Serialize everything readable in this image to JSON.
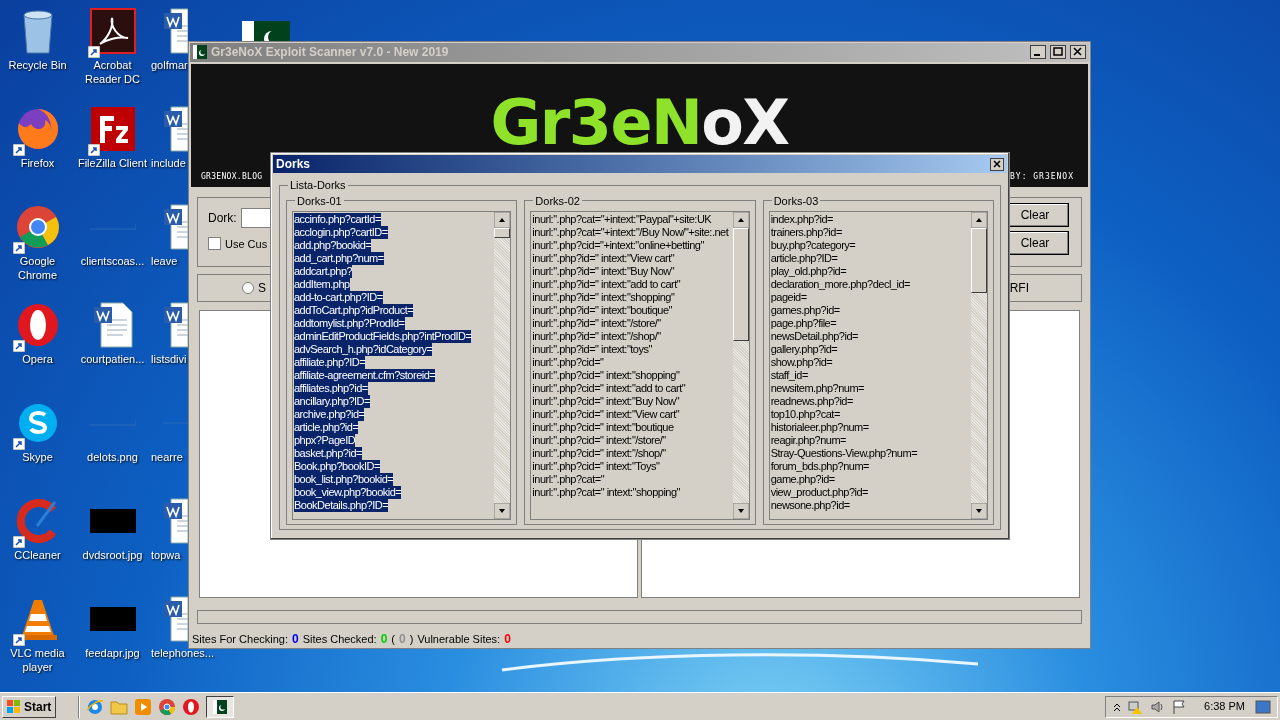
{
  "desktop_icons": [
    {
      "label": "Recycle Bin",
      "kind": "recycle"
    },
    {
      "label": "Firefox",
      "kind": "firefox"
    },
    {
      "label": "Google Chrome",
      "kind": "chrome"
    },
    {
      "label": "Opera",
      "kind": "opera"
    },
    {
      "label": "Skype",
      "kind": "skype"
    },
    {
      "label": "CCleaner",
      "kind": "ccleaner"
    },
    {
      "label": "VLC media player",
      "kind": "vlc"
    },
    {
      "label": "Acrobat Reader DC",
      "kind": "pdf"
    },
    {
      "label": "FileZilla Client",
      "kind": "filezilla"
    },
    {
      "label": "clientscoas...",
      "kind": "blank"
    },
    {
      "label": "courtpatien...",
      "kind": "word"
    },
    {
      "label": "delots.png",
      "kind": "blank"
    },
    {
      "label": "dvdsroot.jpg",
      "kind": "black"
    },
    {
      "label": "feedapr.jpg",
      "kind": "black"
    },
    {
      "label": "golfmar",
      "kind": "word"
    },
    {
      "label": "include",
      "kind": "word"
    },
    {
      "label": "leave",
      "kind": "word"
    },
    {
      "label": "listsdivi",
      "kind": "word"
    },
    {
      "label": "nearre",
      "kind": "blank"
    },
    {
      "label": "topwa",
      "kind": "word"
    },
    {
      "label": "telephones...",
      "kind": "word"
    },
    {
      "kind": "flag"
    }
  ],
  "main_window": {
    "title": "Gr3eNoX Exploit Scanner v7.0 - New 2019",
    "logo_parts": [
      {
        "text": "Gr3eN",
        "kind": "green"
      },
      {
        "text": "oX",
        "kind": "white"
      }
    ],
    "banner_left": "GR3ENOX.BLOG",
    "banner_right": "BY: GR3ENOX",
    "dork_label": "Dork:",
    "use_custom": {
      "label": "Use Cus",
      "checked": false
    },
    "buttons": [
      "Clear",
      "Clear"
    ],
    "radios": [
      {
        "label": "S",
        "selected": false
      },
      {
        "label": "RFI"
      }
    ],
    "progress": {
      "level": 0
    },
    "status": [
      {
        "text": "Sites For Checking:",
        "kind": "label"
      },
      {
        "text": "0",
        "kind": "value",
        "color": "#0000ff"
      },
      {
        "text": "Sites Checked:",
        "kind": "label"
      },
      {
        "text": "0",
        "kind": "value",
        "color": "#00cc00"
      },
      {
        "text": "(",
        "kind": "label"
      },
      {
        "text": "0",
        "kind": "value",
        "color": "#909090"
      },
      {
        "text": ")",
        "kind": "label"
      },
      {
        "text": "Vulnerable Sites:",
        "kind": "label"
      },
      {
        "text": "0",
        "kind": "value",
        "color": "#ff0000"
      }
    ]
  },
  "dialog": {
    "title": "Dorks",
    "group": "Lista-Dorks",
    "lists": [
      {
        "title": "Dorks-01",
        "items": [
          {
            "text": "accinfo.php?cartId=",
            "selected": true
          },
          {
            "text": "acclogin.php?cartID=",
            "selected": true
          },
          {
            "text": "add.php?bookid=",
            "selected": true
          },
          {
            "text": "add_cart.php?num=",
            "selected": true
          },
          {
            "text": "addcart.php?",
            "selected": true
          },
          {
            "text": "addItem.php",
            "selected": true
          },
          {
            "text": "add-to-cart.php?ID=",
            "selected": true
          },
          {
            "text": "addToCart.php?idProduct=",
            "selected": true
          },
          {
            "text": "addtomylist.php?ProdId=",
            "selected": true
          },
          {
            "text": "adminEditProductFields.php?intProdID=",
            "selected": true
          },
          {
            "text": "advSearch_h.php?idCategory=",
            "selected": true
          },
          {
            "text": "affiliate.php?ID=",
            "selected": true
          },
          {
            "text": "affiliate-agreement.cfm?storeid=",
            "selected": true
          },
          {
            "text": "affiliates.php?id=",
            "selected": true
          },
          {
            "text": "ancillary.php?ID=",
            "selected": true
          },
          {
            "text": "archive.php?id=",
            "selected": true
          },
          {
            "text": "article.php?id=",
            "selected": true
          },
          {
            "text": "phpx?PageID",
            "selected": true
          },
          {
            "text": "basket.php?id=",
            "selected": true
          },
          {
            "text": "Book.php?bookID=",
            "selected": true
          },
          {
            "text": "book_list.php?bookid=",
            "selected": true
          },
          {
            "text": "book_view.php?bookid=",
            "selected": true
          },
          {
            "text": "BookDetails.php?ID=",
            "selected": true
          }
        ]
      },
      {
        "title": "Dorks-02",
        "items": [
          {
            "text": "inurl:\".php?cat=\"+intext:\"Paypal\"+site:UK",
            "selected": false
          },
          {
            "text": "inurl:\".php?cat=\"+intext:\"/Buy Now/\"+site:.net",
            "selected": false
          },
          {
            "text": "inurl:\".php?cid=\"+intext:\"online+betting\"",
            "selected": false
          },
          {
            "text": "inurl:\".php?id=\" intext:\"View cart\"",
            "selected": false
          },
          {
            "text": "inurl:\".php?id=\" intext:\"Buy Now\"",
            "selected": false
          },
          {
            "text": "inurl:\".php?id=\" intext:\"add to cart\"",
            "selected": false
          },
          {
            "text": "inurl:\".php?id=\" intext:\"shopping\"",
            "selected": false
          },
          {
            "text": "inurl:\".php?id=\" intext:\"boutique\"",
            "selected": false
          },
          {
            "text": "inurl:\".php?id=\" intext:\"/store/\"",
            "selected": false
          },
          {
            "text": "inurl:\".php?id=\" intext:\"/shop/\"",
            "selected": false
          },
          {
            "text": "inurl:\".php?id=\" intext:\"toys\"",
            "selected": false
          },
          {
            "text": "inurl:\".php?cid=\"",
            "selected": false
          },
          {
            "text": "inurl:\".php?cid=\" intext:\"shopping\"",
            "selected": false
          },
          {
            "text": "inurl:\".php?cid=\" intext:\"add to cart\"",
            "selected": false
          },
          {
            "text": "inurl:\".php?cid=\" intext:\"Buy Now\"",
            "selected": false
          },
          {
            "text": "inurl:\".php?cid=\" intext:\"View cart\"",
            "selected": false
          },
          {
            "text": "inurl:\".php?cid=\" intext:\"boutique",
            "selected": false
          },
          {
            "text": "inurl:\".php?cid=\" intext:\"/store/\"",
            "selected": false
          },
          {
            "text": "inurl:\".php?cid=\" intext:\"/shop/\"",
            "selected": false
          },
          {
            "text": "inurl:\".php?cid=\" intext:\"Toys\"",
            "selected": false
          },
          {
            "text": "inurl:\".php?cat=\"",
            "selected": false
          },
          {
            "text": "inurl:\".php?cat=\" intext:\"shopping\"",
            "selected": false
          }
        ]
      },
      {
        "title": "Dorks-03",
        "items": [
          {
            "text": "index.php?id=",
            "selected": false
          },
          {
            "text": "trainers.php?id=",
            "selected": false
          },
          {
            "text": "buy.php?category=",
            "selected": false
          },
          {
            "text": "article.php?ID=",
            "selected": false
          },
          {
            "text": "play_old.php?id=",
            "selected": false
          },
          {
            "text": "declaration_more.php?decl_id=",
            "selected": false
          },
          {
            "text": "pageid=",
            "selected": false
          },
          {
            "text": "games.php?id=",
            "selected": false
          },
          {
            "text": "page.php?file=",
            "selected": false
          },
          {
            "text": "newsDetail.php?id=",
            "selected": false
          },
          {
            "text": "gallery.php?id=",
            "selected": false
          },
          {
            "text": "show.php?id=",
            "selected": false
          },
          {
            "text": "staff_id=",
            "selected": false
          },
          {
            "text": "newsitem.php?num=",
            "selected": false
          },
          {
            "text": "readnews.php?id=",
            "selected": false
          },
          {
            "text": "top10.php?cat=",
            "selected": false
          },
          {
            "text": "historialeer.php?num=",
            "selected": false
          },
          {
            "text": "reagir.php?num=",
            "selected": false
          },
          {
            "text": "Stray-Questions-View.php?num=",
            "selected": false
          },
          {
            "text": "forum_bds.php?num=",
            "selected": false
          },
          {
            "text": "game.php?id=",
            "selected": false
          },
          {
            "text": "view_product.php?id=",
            "selected": false
          },
          {
            "text": "newsone.php?id=",
            "selected": false
          }
        ]
      }
    ]
  },
  "taskbar": {
    "start": "Start",
    "clock": "6:38 PM"
  }
}
